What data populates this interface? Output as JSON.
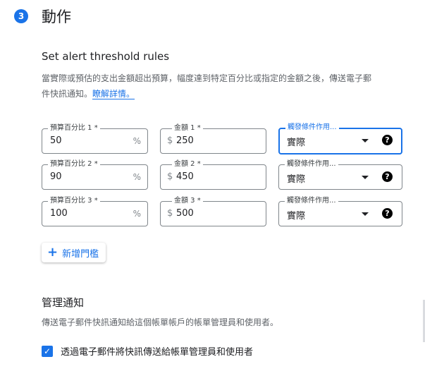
{
  "step": {
    "number": "3",
    "title": "動作"
  },
  "threshold": {
    "heading": "Set alert threshold rules",
    "description_line1": "當實際或預估的支出金額超出預算，幅度達到特定百分比或指定的金額之後，傳送電子郵",
    "description_line2": "件快訊通知。",
    "learn_more": "瞭解詳情。"
  },
  "rules": [
    {
      "percent_label": "預算百分比 1 *",
      "percent_value": "50",
      "percent_suffix": "%",
      "amount_label": "金額 1 *",
      "currency": "$",
      "amount_value": "250",
      "trigger_label": "觸發條件作用...",
      "trigger_value": "實際"
    },
    {
      "percent_label": "預算百分比 2 *",
      "percent_value": "90",
      "percent_suffix": "%",
      "amount_label": "金額 2 *",
      "currency": "$",
      "amount_value": "450",
      "trigger_label": "觸發條件作用...",
      "trigger_value": "實際"
    },
    {
      "percent_label": "預算百分比 3 *",
      "percent_value": "100",
      "percent_suffix": "%",
      "amount_label": "金額 3 *",
      "currency": "$",
      "amount_value": "500",
      "trigger_label": "觸發條件作用...",
      "trigger_value": "實際"
    }
  ],
  "add_threshold": {
    "label": "新增門檻"
  },
  "notifications": {
    "heading": "管理通知",
    "description": "傳送電子郵件快訊通知給這個帳單帳戶的帳單管理員和使用者。",
    "checkbox_label": "透過電子郵件將快訊傳送給帳單管理員和使用者",
    "checked": true
  },
  "colors": {
    "accent": "#1a73e8",
    "border": "#80868b",
    "text": "#202124",
    "muted": "#5f6368"
  },
  "icons": {
    "step": "step-number-badge",
    "dropdown": "chevron-down-icon",
    "help": "help-circle-icon",
    "add": "plus-icon",
    "check": "checkmark-icon"
  }
}
